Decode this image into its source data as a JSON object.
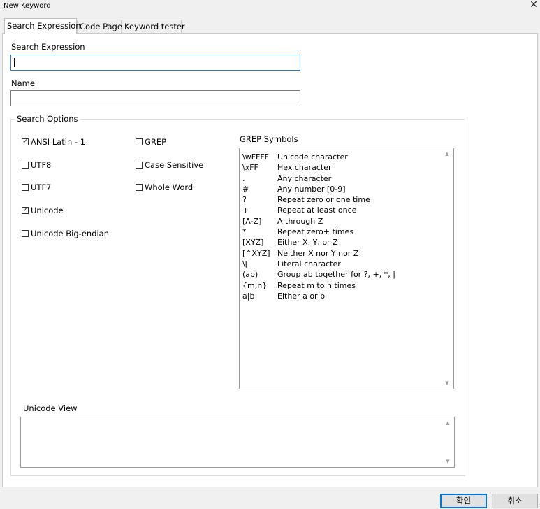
{
  "window": {
    "title": "New Keyword",
    "close_symbol": "✕"
  },
  "tabs": [
    "Search Expression",
    "Code Page",
    "Keyword tester"
  ],
  "search_expression": {
    "label": "Search Expression",
    "value": ""
  },
  "name": {
    "label": "Name",
    "value": ""
  },
  "search_options": {
    "legend": "Search Options",
    "encodings": [
      {
        "label": "ANSI Latin - 1",
        "checked": true
      },
      {
        "label": "UTF8",
        "checked": false
      },
      {
        "label": "UTF7",
        "checked": false
      },
      {
        "label": "Unicode",
        "checked": true
      },
      {
        "label": "Unicode Big-endian",
        "checked": false
      }
    ],
    "flags": [
      {
        "label": "GREP",
        "checked": false
      },
      {
        "label": "Case Sensitive",
        "checked": false
      },
      {
        "label": "Whole Word",
        "checked": false
      }
    ]
  },
  "grep_symbols": {
    "label": "GREP Symbols",
    "rows": [
      {
        "symbol": "\\wFFFF",
        "description": "Unicode character"
      },
      {
        "symbol": "\\xFF",
        "description": "Hex character"
      },
      {
        "symbol": ".",
        "description": "Any character"
      },
      {
        "symbol": "#",
        "description": "Any number [0-9]"
      },
      {
        "symbol": "?",
        "description": "Repeat zero or one time"
      },
      {
        "symbol": "+",
        "description": "Repeat at least once"
      },
      {
        "symbol": "[A-Z]",
        "description": "A through Z"
      },
      {
        "symbol": "*",
        "description": "Repeat zero+ times"
      },
      {
        "symbol": "[XYZ]",
        "description": "Either X, Y, or Z"
      },
      {
        "symbol": "[^XYZ]",
        "description": "Neither X nor Y nor Z"
      },
      {
        "symbol": "\\[",
        "description": "Literal character"
      },
      {
        "symbol": "(ab)",
        "description": "Group ab together for ?, +, *, |"
      },
      {
        "symbol": "{m,n}",
        "description": "Repeat m to n times"
      },
      {
        "symbol": "a|b",
        "description": "Either a or b"
      }
    ]
  },
  "unicode_view": {
    "label": "Unicode View",
    "value": ""
  },
  "buttons": {
    "ok": "확인",
    "cancel": "취소"
  }
}
